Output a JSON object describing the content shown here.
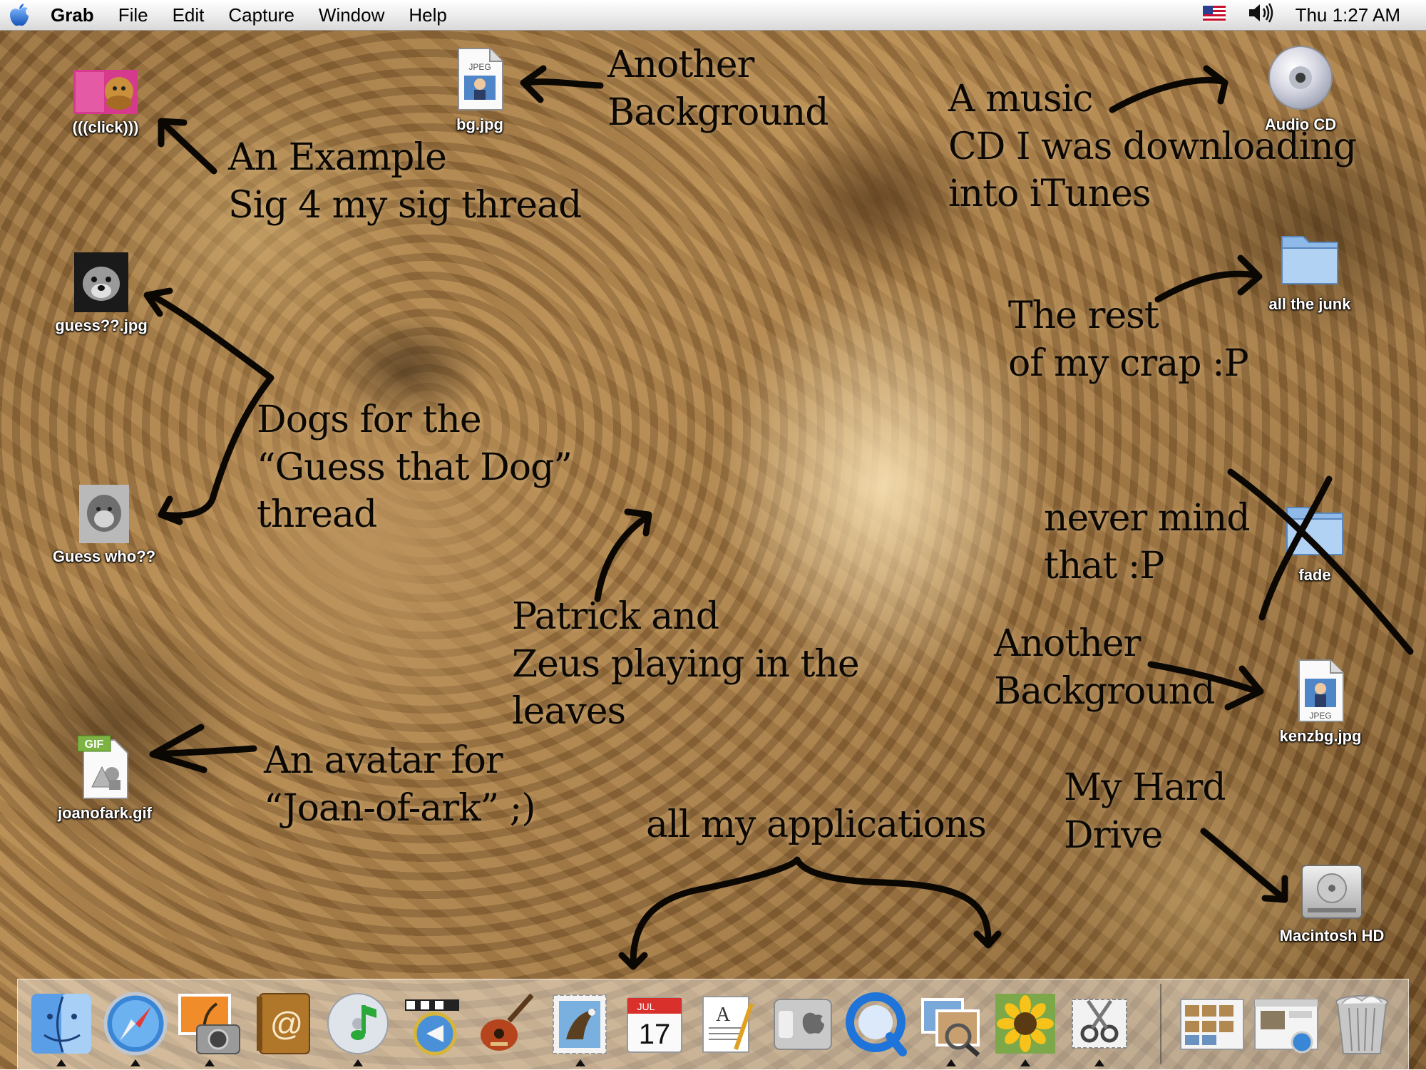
{
  "menubar": {
    "app_name": "Grab",
    "menus": [
      "File",
      "Edit",
      "Capture",
      "Window",
      "Help"
    ],
    "clock": "Thu 1:27 AM"
  },
  "desktop_icons": {
    "click": "(((click)))",
    "bg": "bg.jpg",
    "guess": "guess??.jpg",
    "guesswho": "Guess who??",
    "joan": "joanofark.gif",
    "audiocd": "Audio CD",
    "junk": "all the junk",
    "fade": "fade",
    "kenzbg": "kenzbg.jpg",
    "hd": "Macintosh HD"
  },
  "icon_badges": {
    "jpeg": "JPEG",
    "gif": "GIF",
    "calendar_month": "JUL",
    "calendar_day": "17"
  },
  "annotations": {
    "another_bg_top": [
      "Another",
      "Background"
    ],
    "example_sig": [
      "An Example",
      "Sig 4 my sig thread"
    ],
    "music_cd": [
      "A music",
      "CD I was downloading",
      "into iTunes"
    ],
    "rest_crap": [
      "The rest",
      "of my crap :P"
    ],
    "dogs": [
      "Dogs for the",
      "“Guess that Dog”",
      "thread"
    ],
    "never_mind": [
      "never mind",
      "that :P"
    ],
    "patrick": [
      "Patrick and",
      "Zeus playing in the",
      "leaves"
    ],
    "another_bg_right": [
      "Another",
      "Background"
    ],
    "avatar": [
      "An avatar for",
      "“Joan-of-ark” ;)"
    ],
    "applications": "all my applications",
    "hard_drive": [
      "My Hard",
      "Drive"
    ]
  },
  "dock_items": [
    {
      "icon": "finder-icon",
      "running": true
    },
    {
      "icon": "safari-icon",
      "running": true
    },
    {
      "icon": "iphoto-icon",
      "running": true
    },
    {
      "icon": "address-book-icon",
      "running": false
    },
    {
      "icon": "itunes-icon",
      "running": true
    },
    {
      "icon": "imovie-icon",
      "running": false
    },
    {
      "icon": "garageband-icon",
      "running": false
    },
    {
      "icon": "mail-icon",
      "running": true
    },
    {
      "icon": "ical-icon",
      "running": false
    },
    {
      "icon": "textedit-icon",
      "running": false
    },
    {
      "icon": "system-preferences-icon",
      "running": false
    },
    {
      "icon": "quicktime-icon",
      "running": false
    },
    {
      "icon": "preview-icon",
      "running": true
    },
    {
      "icon": "sunflower-image-icon",
      "running": true
    },
    {
      "icon": "grab-icon",
      "running": true
    },
    {
      "icon": "minimized-window-1-icon",
      "running": false
    },
    {
      "icon": "minimized-window-2-icon",
      "running": false
    },
    {
      "icon": "trash-icon",
      "running": false
    }
  ],
  "colors": {
    "ink": "#0b0804",
    "sepia": "#a57a45",
    "menubar": "#ececec"
  }
}
